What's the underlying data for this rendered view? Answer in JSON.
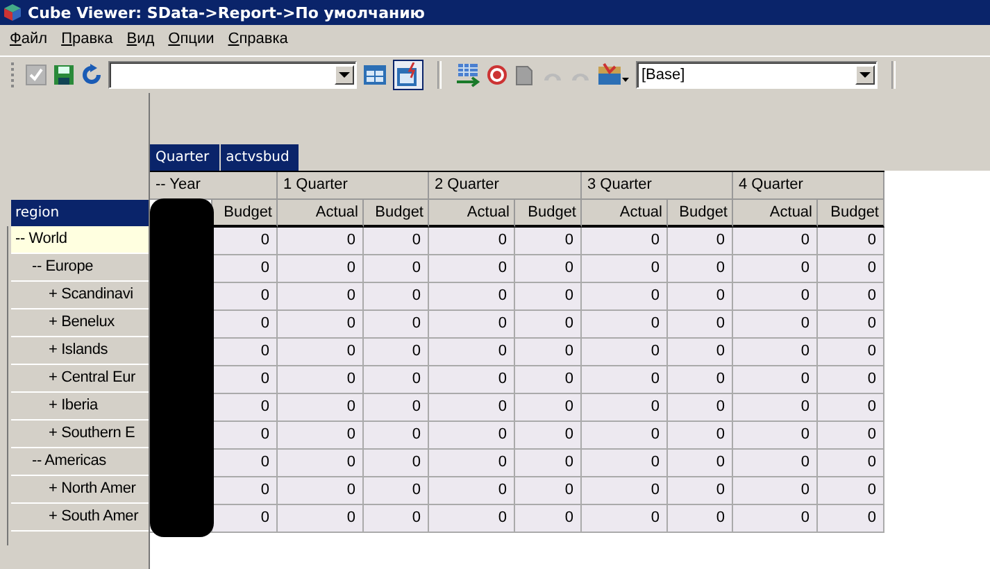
{
  "window": {
    "title": "Cube Viewer: SData->Report->По умолчанию"
  },
  "menu": [
    "Файл",
    "Правка",
    "Вид",
    "Опции",
    "Справка"
  ],
  "toolbar": {
    "subset_combo": {
      "value": "[Base]"
    }
  },
  "column_tabs": [
    "Quarter",
    "actvsbud"
  ],
  "row_header": "region",
  "column_groups": [
    {
      "label": "-- Year",
      "columns": [
        "Budget"
      ]
    },
    {
      "label": "1 Quarter",
      "columns": [
        "Actual",
        "Budget"
      ]
    },
    {
      "label": "2 Quarter",
      "columns": [
        "Actual",
        "Budget"
      ]
    },
    {
      "label": "3 Quarter",
      "columns": [
        "Actual",
        "Budget"
      ]
    },
    {
      "label": "4 Quarter",
      "columns": [
        "Actual",
        "Budget"
      ]
    }
  ],
  "rows": [
    {
      "label": "-- World",
      "selected": true,
      "values": [
        "0",
        "0",
        "0",
        "0",
        "0",
        "0",
        "0",
        "0",
        "0"
      ],
      "children": [
        {
          "label": "-- Europe",
          "selected": false,
          "values": [
            "0",
            "0",
            "0",
            "0",
            "0",
            "0",
            "0",
            "0",
            "0"
          ],
          "children": [
            {
              "label": "+ Scandinavi",
              "selected": false,
              "values": [
                "0",
                "0",
                "0",
                "0",
                "0",
                "0",
                "0",
                "0",
                "0"
              ]
            },
            {
              "label": "+ Benelux",
              "selected": false,
              "values": [
                "0",
                "0",
                "0",
                "0",
                "0",
                "0",
                "0",
                "0",
                "0"
              ]
            },
            {
              "label": "+ Islands",
              "selected": false,
              "values": [
                "0",
                "0",
                "0",
                "0",
                "0",
                "0",
                "0",
                "0",
                "0"
              ]
            },
            {
              "label": "+ Central Eur",
              "selected": false,
              "values": [
                "0",
                "0",
                "0",
                "0",
                "0",
                "0",
                "0",
                "0",
                "0"
              ]
            },
            {
              "label": "+ Iberia",
              "selected": false,
              "values": [
                "0",
                "0",
                "0",
                "0",
                "0",
                "0",
                "0",
                "0",
                "0"
              ]
            },
            {
              "label": "+ Southern E",
              "selected": false,
              "values": [
                "0",
                "0",
                "0",
                "0",
                "0",
                "0",
                "0",
                "0",
                "0"
              ]
            }
          ]
        },
        {
          "label": "-- Americas",
          "selected": false,
          "values": [
            "0",
            "0",
            "0",
            "0",
            "0",
            "0",
            "0",
            "0",
            "0"
          ],
          "children": [
            {
              "label": "+ North Amer",
              "selected": false,
              "values": [
                "0",
                "0",
                "0",
                "0",
                "0",
                "0",
                "0",
                "0",
                "0"
              ]
            },
            {
              "label": "+ South Amer",
              "selected": false,
              "values": [
                "0",
                "0",
                "0",
                "0",
                "0",
                "0",
                "0",
                "0",
                "0"
              ]
            }
          ]
        }
      ]
    }
  ]
}
